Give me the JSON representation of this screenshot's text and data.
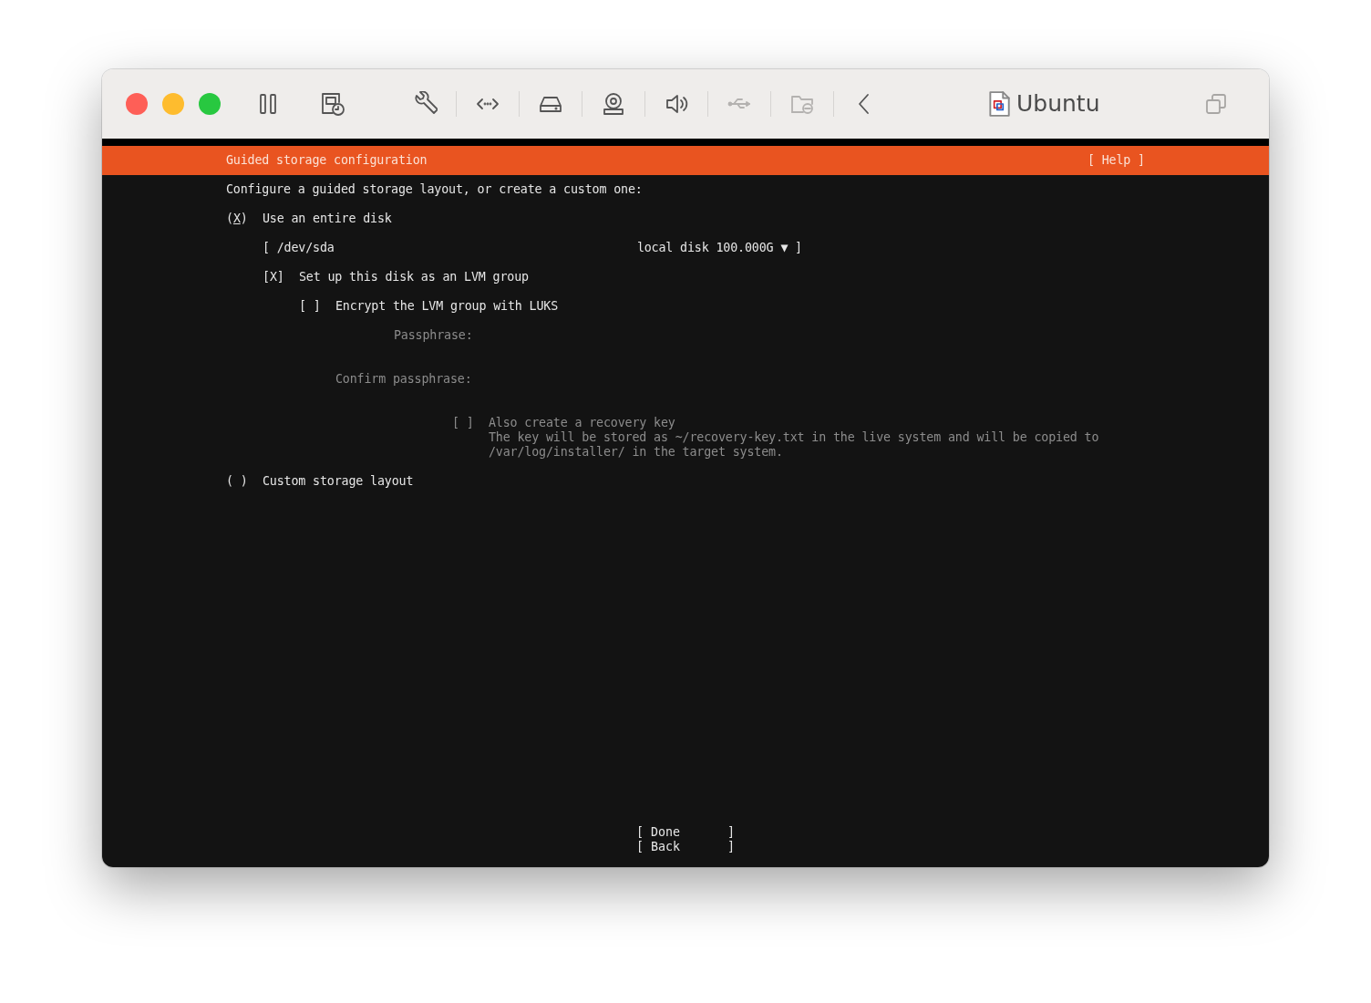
{
  "window": {
    "title": "Ubuntu",
    "toolbar": [
      {
        "kind": "pause",
        "disabled": false
      },
      {
        "kind": "snapshot",
        "disabled": false
      },
      {
        "kind": "wrench",
        "disabled": false
      },
      {
        "kind": "code",
        "disabled": false
      },
      {
        "kind": "drive",
        "disabled": false
      },
      {
        "kind": "camera",
        "disabled": false
      },
      {
        "kind": "speaker",
        "disabled": false
      },
      {
        "kind": "usb",
        "disabled": true
      },
      {
        "kind": "folder",
        "disabled": true
      },
      {
        "kind": "chevron",
        "disabled": false
      }
    ]
  },
  "header": {
    "title": "Guided storage configuration",
    "help": "[ Help ]"
  },
  "prompt": "Configure a guided storage layout, or create a custom one:",
  "entire_disk": {
    "brackets": [
      "(",
      ")"
    ],
    "tick": "X",
    "label": "Use an entire disk",
    "selected": true,
    "focused": true
  },
  "disk_dropdown": {
    "open": "[",
    "device": "/dev/sda",
    "description": "local disk 100.000G",
    "caret": "▼",
    "close": "]"
  },
  "lvm": {
    "brackets": [
      "[",
      "]"
    ],
    "tick": "X",
    "label": "Set up this disk as an LVM group",
    "checked": true,
    "disabled": false
  },
  "encrypt": {
    "brackets": [
      "[",
      "]"
    ],
    "label": "Encrypt the LVM group with LUKS",
    "checked": false,
    "disabled": false
  },
  "passphrase": {
    "label": "Passphrase:",
    "disabled": true
  },
  "confirm_passphrase": {
    "label": "Confirm passphrase:",
    "disabled": true
  },
  "recovery_key": {
    "brackets": [
      "[",
      "]"
    ],
    "label": "Also create a recovery key",
    "checked": false,
    "disabled": true,
    "note_lines": [
      "The key will be stored as ~/recovery-key.txt in the live system and will be copied to",
      "/var/log/installer/ in the target system."
    ]
  },
  "custom_layout": {
    "brackets": [
      "(",
      ")"
    ],
    "label": "Custom storage layout",
    "selected": false,
    "focused": false
  },
  "buttons": [
    {
      "open": "[",
      "label": "Done",
      "close": "]"
    },
    {
      "open": "[",
      "label": "Back",
      "close": "]"
    }
  ]
}
